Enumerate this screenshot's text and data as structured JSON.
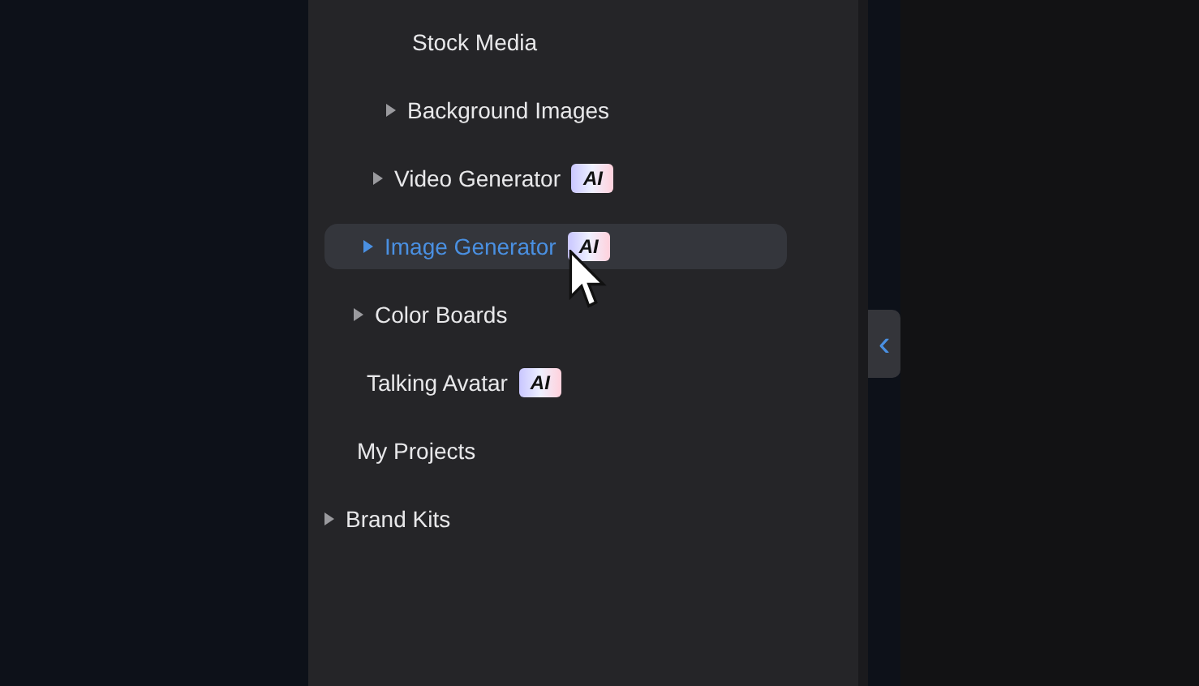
{
  "sidebar": {
    "items": [
      {
        "label": "Stock Media",
        "expandable": false,
        "selected": false
      },
      {
        "label": "Background Images",
        "expandable": true,
        "selected": false
      },
      {
        "label": "Video Generator",
        "expandable": true,
        "badge": "AI",
        "selected": false
      },
      {
        "label": "Image Generator",
        "expandable": true,
        "badge": "AI",
        "selected": true
      },
      {
        "label": "Color Boards",
        "expandable": true,
        "selected": false
      },
      {
        "label": "Talking Avatar",
        "expandable": false,
        "badge": "AI",
        "selected": false
      },
      {
        "label": "My Projects",
        "expandable": false,
        "selected": false
      },
      {
        "label": "Brand Kits",
        "expandable": true,
        "selected": false
      }
    ]
  },
  "collapse_button": {
    "glyph": "‹"
  }
}
